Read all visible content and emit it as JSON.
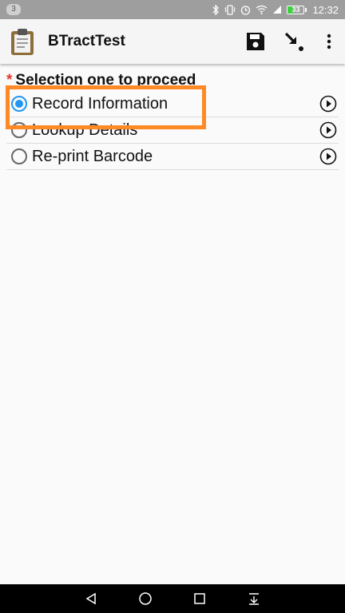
{
  "status_bar": {
    "notification_count": "3",
    "battery_level": "33",
    "time": "12:32",
    "icons": [
      "bluetooth-icon",
      "vibrate-icon",
      "alarm-icon",
      "wifi-icon",
      "signal-icon",
      "battery-icon"
    ]
  },
  "app_bar": {
    "title": "BTractTest",
    "app_icon": "clipboard-icon",
    "actions": [
      "save-icon",
      "go-to-end-icon",
      "overflow-menu-icon"
    ]
  },
  "form": {
    "required_marker": "*",
    "question": "Selection one to proceed",
    "options": [
      {
        "label": "Record Information",
        "selected": true
      },
      {
        "label": "Lookup Details",
        "selected": false
      },
      {
        "label": "Re-print Barcode",
        "selected": false
      }
    ]
  },
  "colors": {
    "accent": "#2196f3",
    "highlight": "#ff8a25",
    "required": "#e53935"
  },
  "nav_bar": {
    "buttons": [
      "back-icon",
      "home-icon",
      "recents-icon",
      "notifications-pull-icon"
    ]
  }
}
